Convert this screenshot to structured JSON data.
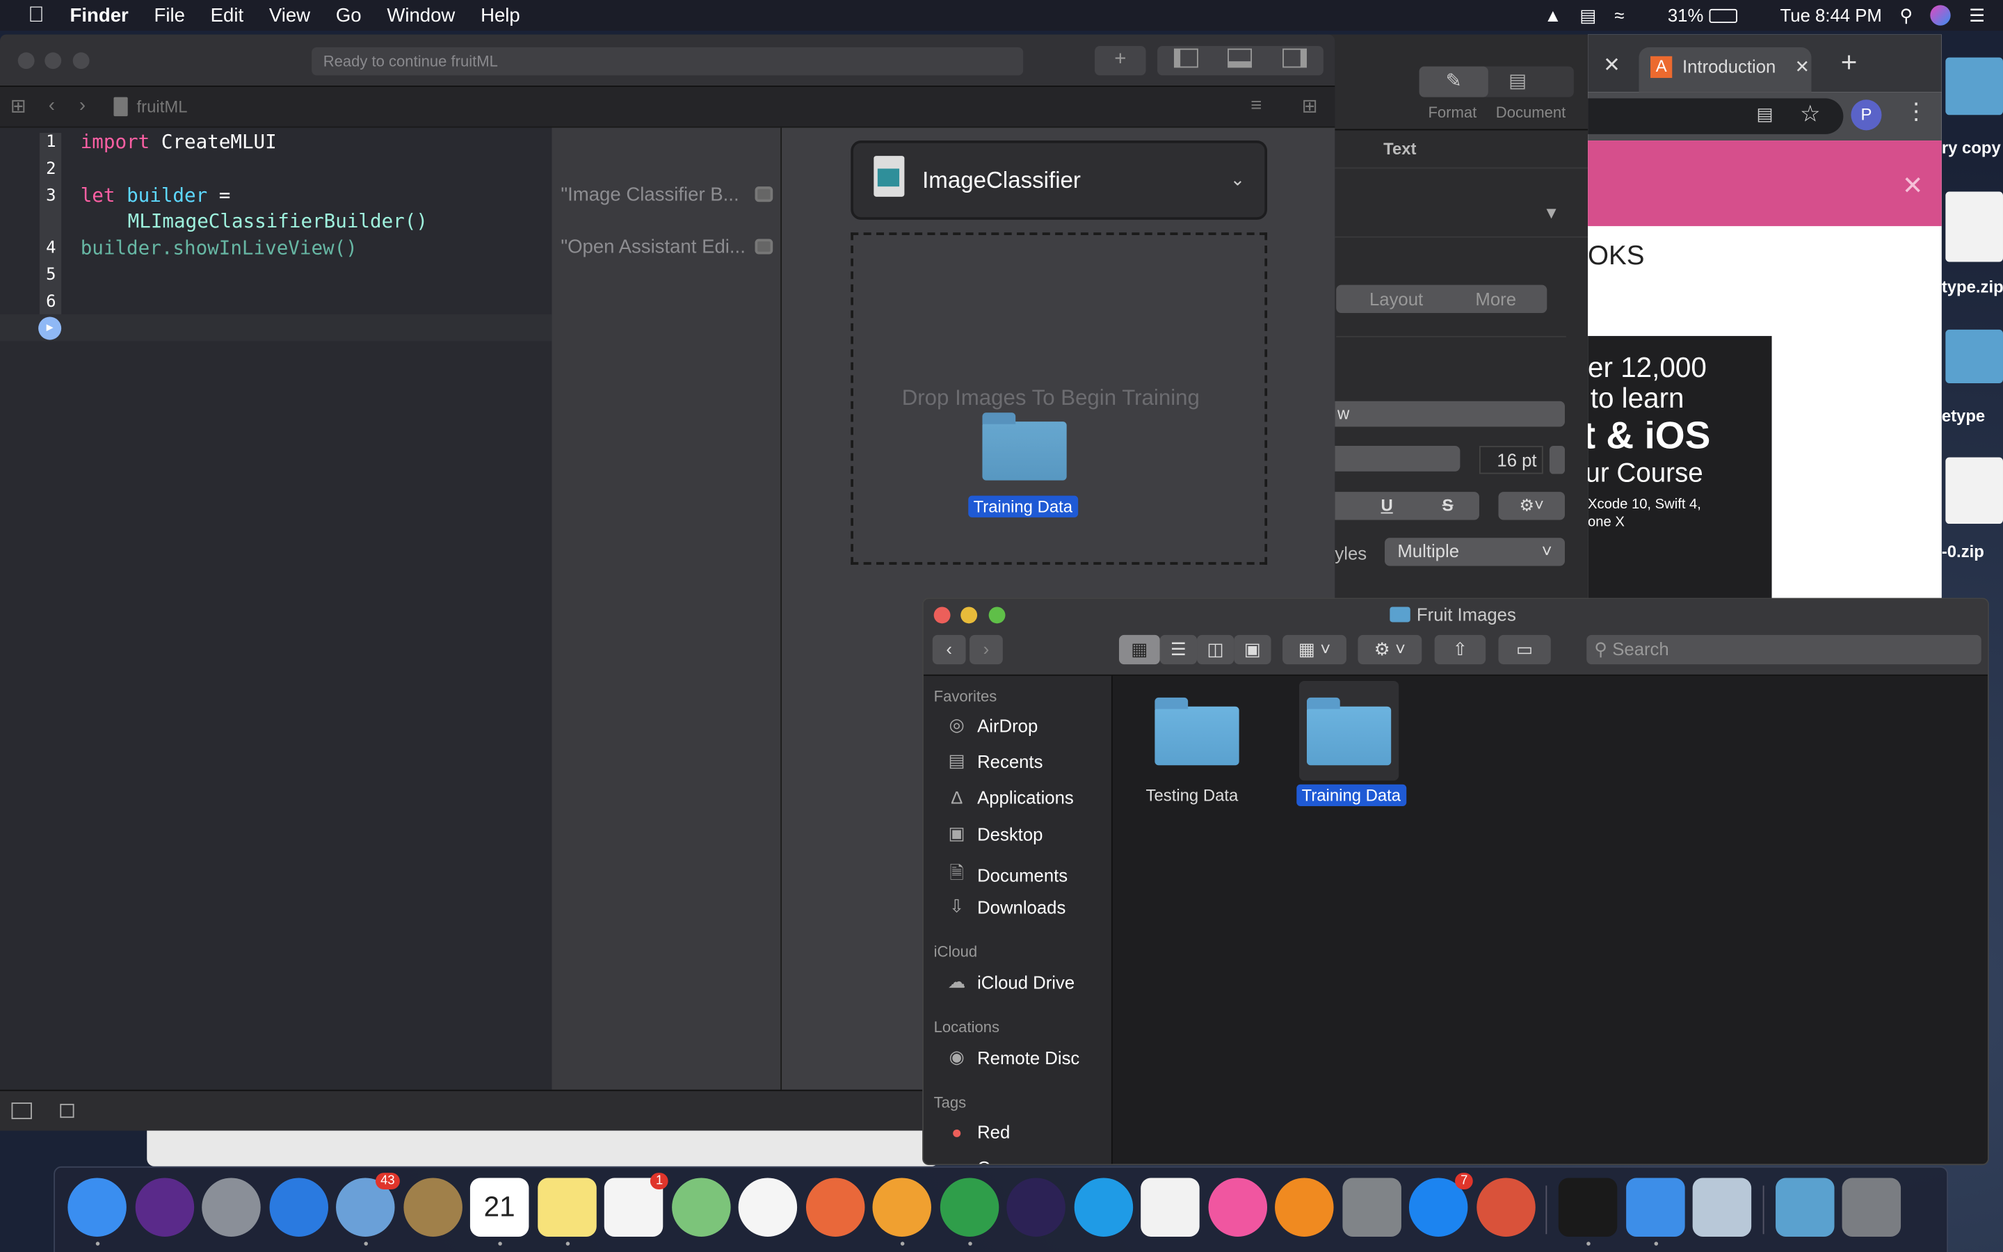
{
  "menubar": {
    "app": "Finder",
    "items": [
      "File",
      "Edit",
      "View",
      "Go",
      "Window",
      "Help"
    ],
    "battery": "31%",
    "clock": "Tue 8:44 PM"
  },
  "xcode": {
    "status": "Ready to continue fruitML",
    "file": "fruitML",
    "lines": [
      "1",
      "2",
      "3",
      "4",
      "5",
      "6"
    ],
    "code": {
      "import_kw": "import",
      "import_mod": "CreateMLUI",
      "let_kw": "let",
      "var": "builder",
      "eq": "=",
      "ctor": "MLImageClassifierBuilder()",
      "call": "builder.showInLiveView()"
    },
    "results": [
      "\"Image Classifier B...",
      "\"Open Assistant Edi..."
    ],
    "live": {
      "model": "ImageClassifier",
      "drop_hint": "Drop Images To Begin Training",
      "dragged_folder": "Training Data"
    }
  },
  "inspector": {
    "tabs": [
      "Format",
      "Document"
    ],
    "section": "Text",
    "segments": [
      "Layout",
      "More"
    ],
    "font_partial": "w",
    "size": "16 pt",
    "styles_label": "yles",
    "styles_value": "Multiple",
    "underline": "U",
    "strike": "S"
  },
  "chrome": {
    "tab": "Introduction",
    "avatar": "P",
    "heading_partial": "OKS",
    "promo": [
      "er 12,000",
      "to learn",
      "t & iOS",
      "ur Course",
      "Xcode 10, Swift 4,",
      "one X"
    ]
  },
  "desktop": {
    "labels": [
      "ry copy",
      "type.zip",
      "etype",
      "-0.zip"
    ]
  },
  "finder": {
    "title": "Fruit Images",
    "search_placeholder": "Search",
    "sections": {
      "favorites": "Favorites",
      "icloud": "iCloud",
      "locations": "Locations",
      "tags": "Tags"
    },
    "favorites": [
      {
        "label": "AirDrop",
        "icon": "airdrop-icon"
      },
      {
        "label": "Recents",
        "icon": "recents-icon"
      },
      {
        "label": "Applications",
        "icon": "applications-icon"
      },
      {
        "label": "Desktop",
        "icon": "desktop-icon"
      },
      {
        "label": "Documents",
        "icon": "documents-icon"
      },
      {
        "label": "Downloads",
        "icon": "downloads-icon"
      }
    ],
    "icloud": [
      {
        "label": "iCloud Drive"
      }
    ],
    "locations": [
      {
        "label": "Remote Disc"
      }
    ],
    "tags": [
      {
        "label": "Red",
        "color": "#ec5f5a"
      },
      {
        "label": "Orange",
        "color": "#f0a030"
      }
    ],
    "files": [
      {
        "name": "Testing Data",
        "selected": false
      },
      {
        "name": "Training Data",
        "selected": true
      }
    ]
  },
  "dock": {
    "apps": [
      {
        "name": "finder",
        "color": "#3a8ef0",
        "running": true
      },
      {
        "name": "siri",
        "color": "#5a2a8a"
      },
      {
        "name": "launchpad",
        "color": "#8a8f98"
      },
      {
        "name": "safari",
        "color": "#2a7ae0"
      },
      {
        "name": "mail",
        "color": "#6aa0d8",
        "badge": "43",
        "running": true
      },
      {
        "name": "contacts",
        "color": "#a0804a"
      },
      {
        "name": "calendar",
        "color": "#ffffff",
        "text": "21",
        "running": true
      },
      {
        "name": "notes",
        "color": "#f7e27a",
        "running": true
      },
      {
        "name": "reminders",
        "color": "#f4f4f4",
        "badge": "1"
      },
      {
        "name": "maps",
        "color": "#7cc47a"
      },
      {
        "name": "beaver-app",
        "color": "#f5f5f5"
      },
      {
        "name": "pen-app",
        "color": "#e9683a"
      },
      {
        "name": "pages",
        "color": "#f0a030",
        "running": true
      },
      {
        "name": "chrome",
        "color": "#2f9e4a",
        "running": true
      },
      {
        "name": "eclipse",
        "color": "#2c2255"
      },
      {
        "name": "skype",
        "color": "#1f9be6"
      },
      {
        "name": "numbers",
        "color": "#f2f2f2"
      },
      {
        "name": "itunes",
        "color": "#f056a0"
      },
      {
        "name": "ibooks",
        "color": "#f08a20"
      },
      {
        "name": "system-preferences",
        "color": "#808488"
      },
      {
        "name": "app-store",
        "color": "#1c84f0",
        "badge": "7"
      },
      {
        "name": "remote-desktop",
        "color": "#d9523a"
      },
      {
        "name": "terminal",
        "color": "#1a1a1a",
        "running": true,
        "sep": true
      },
      {
        "name": "xcode",
        "color": "#3d8ee8",
        "running": true
      },
      {
        "name": "preview",
        "color": "#b8c8d8"
      },
      {
        "name": "downloads-folder",
        "color": "#5aa1cf",
        "sep": true
      },
      {
        "name": "trash",
        "color": "#7a7d82"
      }
    ]
  }
}
